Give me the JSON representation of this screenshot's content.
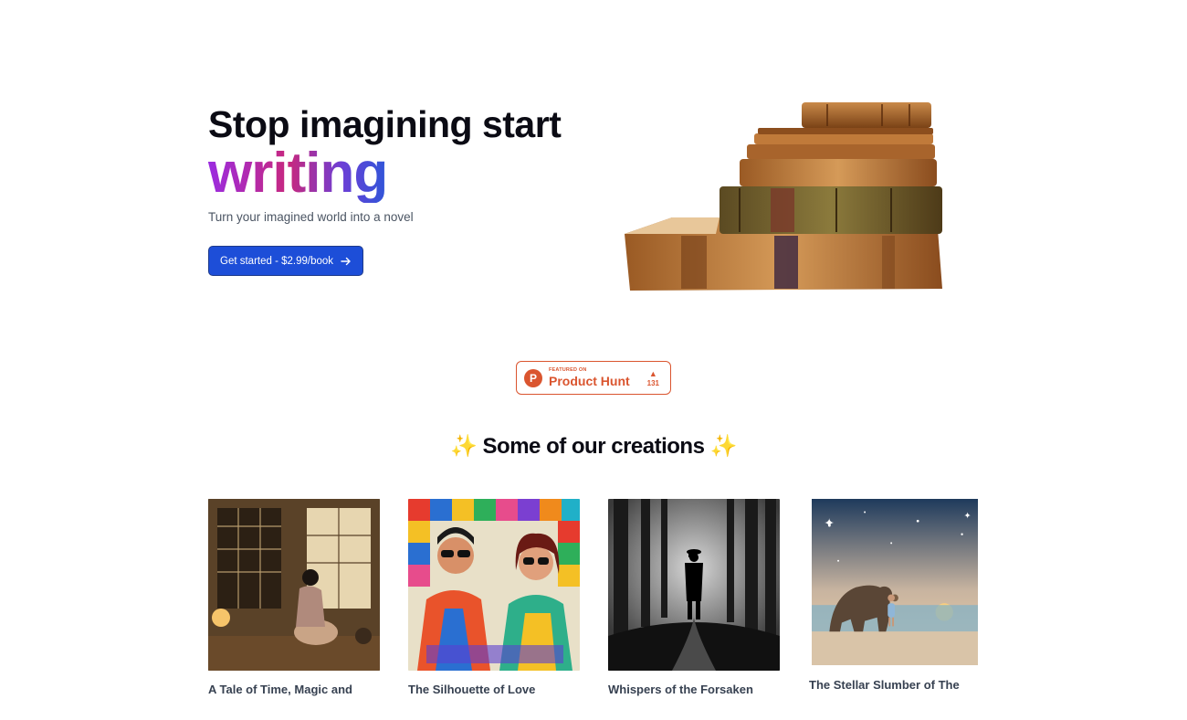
{
  "hero": {
    "headline_line1": "Stop imagining start",
    "headline_accent": "writing",
    "subtitle": "Turn your imagined world into a novel",
    "cta_label": "Get started - $2.99/book",
    "cta_icon": "arrow-right-icon"
  },
  "product_hunt": {
    "featured_label": "FEATURED ON",
    "name": "Product Hunt",
    "logo_letter": "P",
    "upvote_icon": "▲",
    "votes": "131",
    "color": "#da552f"
  },
  "creations": {
    "heading": "Some of our creations",
    "sparkle_left": "✨",
    "sparkle_right": "✨",
    "items": [
      {
        "title": "A Tale of Time, Magic and",
        "image": "woman-reading-japanese-room"
      },
      {
        "title": "The Silhouette of Love",
        "image": "pop-art-couple"
      },
      {
        "title": "Whispers of the Forsaken",
        "image": "dark-forest-figure"
      },
      {
        "title": "The Stellar Slumber of The",
        "image": "bear-and-child-beach"
      }
    ]
  },
  "colors": {
    "primary": "#1d4ed8",
    "accent_gradient": [
      "#9b2ce0",
      "#c7287e",
      "#6b3fd6",
      "#2f56d9"
    ]
  }
}
